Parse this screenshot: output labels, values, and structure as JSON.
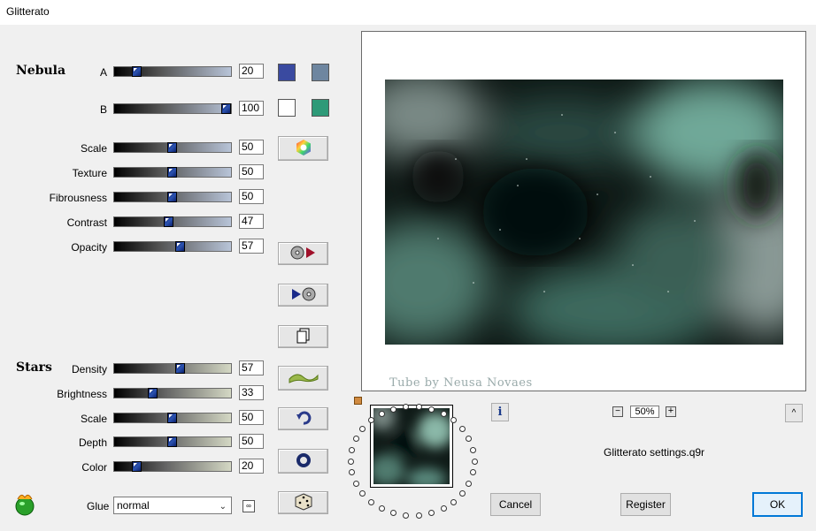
{
  "window": {
    "title": "Glitterato"
  },
  "nebula": {
    "section_label": "Nebula",
    "color_a": {
      "label": "A",
      "value": "20"
    },
    "color_b": {
      "label": "B",
      "value": "100"
    },
    "sliders": [
      {
        "label": "Scale",
        "value": "50"
      },
      {
        "label": "Texture",
        "value": "50"
      },
      {
        "label": "Fibrousness",
        "value": "50"
      },
      {
        "label": "Contrast",
        "value": "47"
      },
      {
        "label": "Opacity",
        "value": "57"
      }
    ],
    "swatches": {
      "a_left": "#3a4aa0",
      "a_right": "#6e86a0",
      "b_left": "#ffffff",
      "b_right": "#2e9a78"
    }
  },
  "stars": {
    "section_label": "Stars",
    "sliders": [
      {
        "label": "Density",
        "value": "57"
      },
      {
        "label": "Brightness",
        "value": "33"
      },
      {
        "label": "Scale",
        "value": "50"
      },
      {
        "label": "Depth",
        "value": "50"
      },
      {
        "label": "Color",
        "value": "20"
      }
    ]
  },
  "glue": {
    "label": "Glue",
    "value": "normal"
  },
  "preview": {
    "watermark": "Tube by Neusa Novaes",
    "zoom": "50%"
  },
  "settings_file": "Glitterato settings.q9r",
  "buttons": {
    "cancel": "Cancel",
    "register": "Register",
    "ok": "OK"
  },
  "icons": [
    "color-wheel-icon",
    "load-preset-icon",
    "save-preset-icon",
    "copy-icon",
    "wave-icon",
    "reset-icon",
    "ring-icon",
    "dice-icon",
    "info-icon",
    "zoom-out-icon",
    "zoom-in-icon",
    "collapse-icon",
    "glitter-logo-icon"
  ]
}
